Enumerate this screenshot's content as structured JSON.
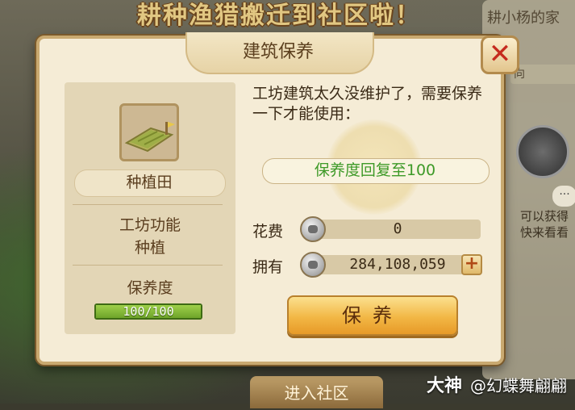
{
  "background": {
    "banner": "耕种渔猎搬迁到社区啦！",
    "right_card_top": "耕小杨的家",
    "right_card_btn": "向",
    "right_dots": "···",
    "right_text_1": "可以获得",
    "right_text_2": "快来看看",
    "bottom_button": "进入社区",
    "watermark_brand": "大神",
    "watermark_user": "@幻蝶舞翩翩"
  },
  "dialog": {
    "title": "建筑保养",
    "close_symbol": "✕",
    "building": {
      "name": "种植田",
      "function_label": "工坊功能",
      "function_value": "种植",
      "maintenance_label": "保养度",
      "maintenance_text": "100/100",
      "maintenance_fraction": 1.0
    },
    "description": "工坊建筑太久没维护了，需要保养一下才能使用：",
    "restore_text": "保养度回复至100",
    "cost_label": "花费",
    "cost_value": "0",
    "own_label": "拥有",
    "own_value": "284,108,059",
    "plus_symbol": "+",
    "confirm_button": "保养"
  },
  "colors": {
    "accent_green": "#3e9a28",
    "button_gold": "#f2b745",
    "close_red": "#c52b1e"
  },
  "icons": [
    "farm-field-icon",
    "silver-coin-icon",
    "plus-icon",
    "close-icon",
    "ellipsis-icon"
  ]
}
